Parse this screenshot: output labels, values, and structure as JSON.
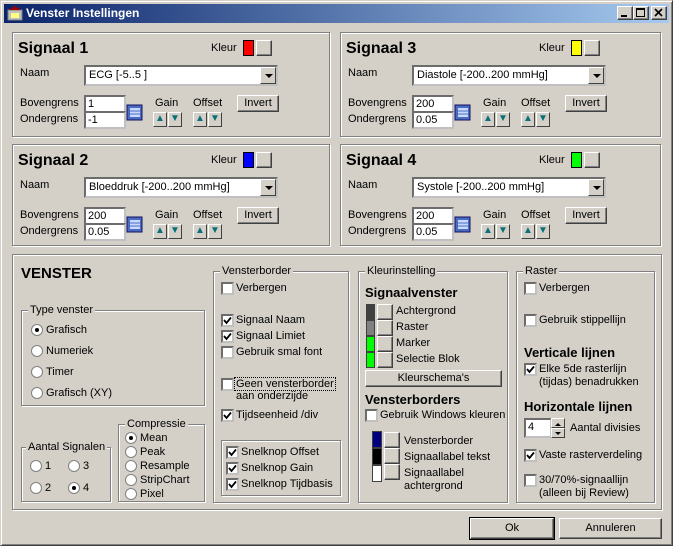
{
  "window": {
    "title": "Venster Instellingen"
  },
  "signals": [
    {
      "title": "Signaal 1",
      "kleur_label": "Kleur",
      "color": "#ff0000",
      "naam_label": "Naam",
      "naam_value": "ECG  [-5..5 ]",
      "boven_label": "Bovengrens",
      "boven_value": "1",
      "onder_label": "Ondergrens",
      "onder_value": "-1",
      "gain_label": "Gain",
      "offset_label": "Offset",
      "invert_label": "Invert"
    },
    {
      "title": "Signaal 3",
      "kleur_label": "Kleur",
      "color": "#ffff00",
      "naam_label": "Naam",
      "naam_value": "Diastole  [-200..200 mmHg]",
      "boven_label": "Bovengrens",
      "boven_value": "200",
      "onder_label": "Ondergrens",
      "onder_value": "0.05",
      "gain_label": "Gain",
      "offset_label": "Offset",
      "invert_label": "Invert"
    },
    {
      "title": "Signaal 2",
      "kleur_label": "Kleur",
      "color": "#0000ff",
      "naam_label": "Naam",
      "naam_value": "Bloeddruk  [-200..200 mmHg]",
      "boven_label": "Bovengrens",
      "boven_value": "200",
      "onder_label": "Ondergrens",
      "onder_value": "0.05",
      "gain_label": "Gain",
      "offset_label": "Offset",
      "invert_label": "Invert"
    },
    {
      "title": "Signaal 4",
      "kleur_label": "Kleur",
      "color": "#00ff00",
      "naam_label": "Naam",
      "naam_value": "Systole  [-200..200 mmHg]",
      "boven_label": "Bovengrens",
      "boven_value": "200",
      "onder_label": "Ondergrens",
      "onder_value": "0.05",
      "gain_label": "Gain",
      "offset_label": "Offset",
      "invert_label": "Invert"
    }
  ],
  "venster": {
    "title": "VENSTER",
    "type_legend": "Type venster",
    "types": [
      "Grafisch",
      "Numeriek",
      "Timer",
      "Grafisch (XY)"
    ],
    "type_selected": "Grafisch",
    "aantal_legend": "Aantal Signalen",
    "aantal_options": [
      "1",
      "3",
      "2",
      "4"
    ],
    "aantal_selected": "4",
    "compressie_legend": "Compressie",
    "compressie_options": [
      "Mean",
      "Peak",
      "Resample",
      "StripChart",
      "Pixel"
    ],
    "compressie_selected": "Mean"
  },
  "vensterborder": {
    "legend": "Vensterborder",
    "verbergen": {
      "label": "Verbergen",
      "checked": false
    },
    "signaal_naam": {
      "label": "Signaal Naam",
      "checked": true
    },
    "signaal_limiet": {
      "label": "Signaal Limiet",
      "checked": true
    },
    "smal_font": {
      "label": "Gebruik smal font",
      "checked": false
    },
    "geen_border_1": "Geen vensterborder",
    "geen_border_2": "aan onderzijde",
    "geen_border_checked": false,
    "tijdseenheid": {
      "label": "Tijdseenheid /div",
      "checked": true
    },
    "snel_offset": {
      "label": "Snelknop Offset",
      "checked": true
    },
    "snel_gain": {
      "label": "Snelknop Gain",
      "checked": true
    },
    "snel_tijdbasis": {
      "label": "Snelknop Tijdbasis",
      "checked": true
    }
  },
  "kleur": {
    "legend": "Kleurinstelling",
    "signaalvenster_heading": "Signaalvenster",
    "items": [
      {
        "label": "Achtergrond",
        "color": "#404040"
      },
      {
        "label": "Raster",
        "color": "#808080"
      },
      {
        "label": "Marker",
        "color": "#00ff00"
      },
      {
        "label": "Selectie Blok",
        "color": "#00ff00"
      }
    ],
    "schema_button": "Kleurschema's",
    "vensterborders_heading": "Vensterborders",
    "windows_kleuren": {
      "label": "Gebruik Windows kleuren",
      "checked": false
    },
    "border_items": [
      {
        "label": "Vensterborder",
        "color": "#000080"
      },
      {
        "label": "Signaallabel tekst",
        "color": "#000000"
      },
      {
        "label": "Signaallabel",
        "label2": "achtergrond",
        "color": "#ffffff"
      }
    ]
  },
  "raster": {
    "legend": "Raster",
    "verbergen": {
      "label": "Verbergen",
      "checked": false
    },
    "stippellijn": {
      "label": "Gebruik stippellijn",
      "checked": false
    },
    "verticale_heading": "Verticale lijnen",
    "elke_5de_1": "Elke 5de rasterlijn",
    "elke_5de_2": "(tijdas) benadrukken",
    "elke_5de_checked": true,
    "horizontale_heading": "Horizontale lijnen",
    "aantal_divisies_value": "4",
    "aantal_divisies_label": "Aantal divisies",
    "vaste_verdeling": {
      "label": "Vaste rasterverdeling",
      "checked": true
    },
    "signaallijn_1": "30/70%-signaallijn",
    "signaallijn_2": "(alleen bij Review)",
    "signaallijn_checked": false
  },
  "buttons": {
    "ok": "Ok",
    "annuleren": "Annuleren"
  }
}
